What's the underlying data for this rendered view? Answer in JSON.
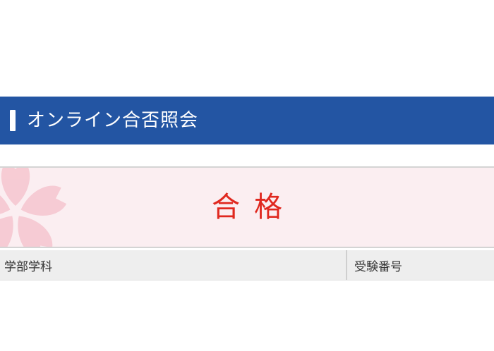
{
  "header": {
    "title": "オンライン合否照会"
  },
  "result": {
    "text": "合格"
  },
  "info_row": {
    "department_label": "学部学科",
    "exam_number_label": "受験番号"
  },
  "colors": {
    "header_bg": "#2355a3",
    "result_bg": "#fbeef1",
    "result_text": "#e0281f",
    "sakura": "#f6c5cf"
  },
  "icons": {
    "decoration": "sakura-flower-icon"
  }
}
